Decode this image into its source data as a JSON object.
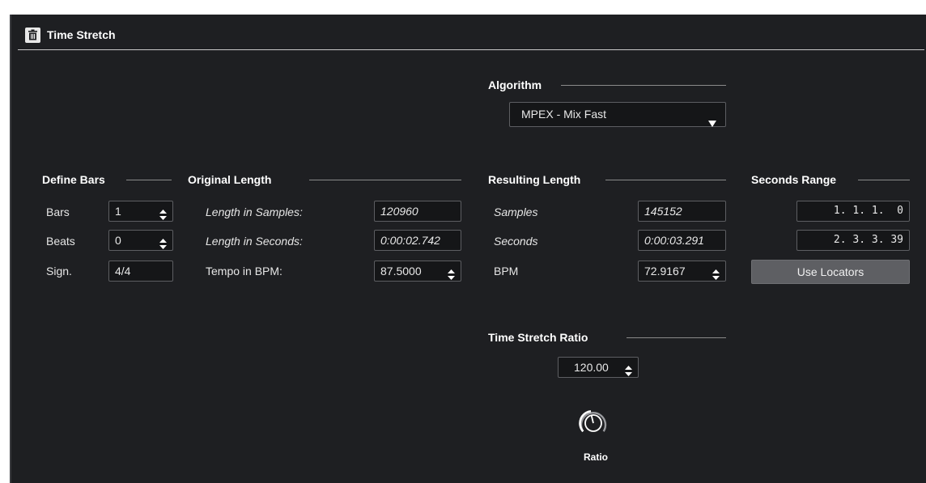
{
  "window": {
    "title": "Time Stretch"
  },
  "algorithm": {
    "heading": "Algorithm",
    "selected": "MPEX - Mix Fast"
  },
  "define_bars": {
    "heading": "Define Bars",
    "bars_label": "Bars",
    "bars_value": "1",
    "beats_label": "Beats",
    "beats_value": "0",
    "sign_label": "Sign.",
    "sign_value": "4/4"
  },
  "original_length": {
    "heading": "Original Length",
    "samples_label": "Length in Samples:",
    "samples_value": "120960",
    "seconds_label": "Length in Seconds:",
    "seconds_value": "0:00:02.742",
    "tempo_label": "Tempo in BPM:",
    "tempo_value": "87.5000"
  },
  "resulting_length": {
    "heading": "Resulting Length",
    "samples_label": "Samples",
    "samples_value": "145152",
    "seconds_label": "Seconds",
    "seconds_value": "0:00:03.291",
    "bpm_label": "BPM",
    "bpm_value": "72.9167"
  },
  "seconds_range": {
    "heading": "Seconds Range",
    "start_value": "1. 1. 1.  0",
    "end_value": "2. 3. 3. 39",
    "use_locators_label": "Use Locators"
  },
  "time_stretch_ratio": {
    "heading": "Time Stretch Ratio",
    "value": "120.00",
    "knob_label": "Ratio"
  },
  "colors": {
    "panel_bg": "#1e1f22",
    "field_bg": "#151618",
    "button_bg": "#5e5f63",
    "text": "#e6e6e6"
  }
}
